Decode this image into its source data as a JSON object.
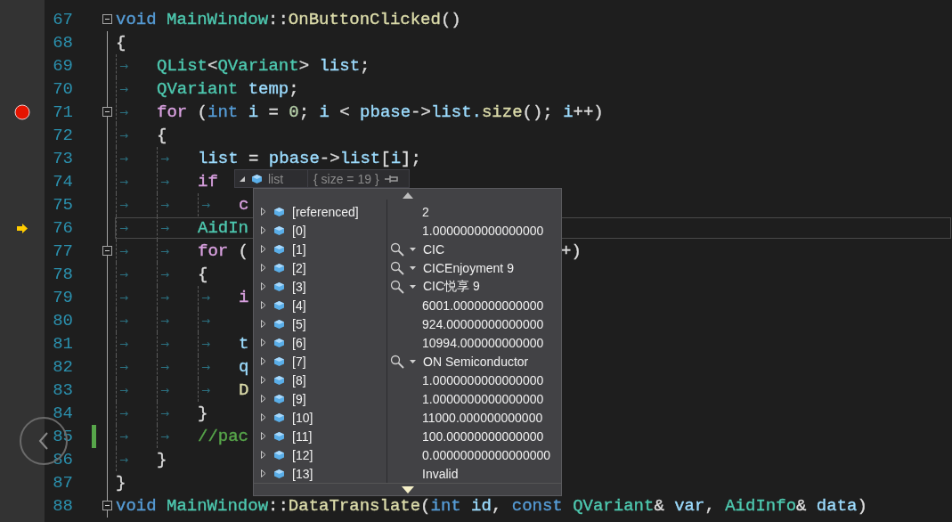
{
  "editor": {
    "lines": [
      {
        "number": "67",
        "collapsible": true,
        "tokens": [
          {
            "kind": "code",
            "text": "void ",
            "color": "#569cd6"
          },
          {
            "kind": "code",
            "text": "MainWindow",
            "color": "#4ec9b0"
          },
          {
            "kind": "code",
            "text": "::",
            "color": "#dcdcdc"
          },
          {
            "kind": "code",
            "text": "OnButtonClicked",
            "color": "#dcdcaa"
          },
          {
            "kind": "code",
            "text": "()",
            "color": "#dcdcdc"
          }
        ]
      },
      {
        "number": "68",
        "tokens": [
          {
            "kind": "code",
            "text": "{",
            "color": "#dcdcdc"
          }
        ]
      },
      {
        "number": "69",
        "tokens": [
          {
            "kind": "tab",
            "text": "→"
          },
          {
            "kind": "code",
            "text": "QList",
            "color": "#4ec9b0"
          },
          {
            "kind": "code",
            "text": "<",
            "color": "#dcdcdc"
          },
          {
            "kind": "code",
            "text": "QVariant",
            "color": "#4ec9b0"
          },
          {
            "kind": "code",
            "text": "> ",
            "color": "#dcdcdc"
          },
          {
            "kind": "code",
            "text": "list",
            "color": "#9cdcfe"
          },
          {
            "kind": "code",
            "text": ";",
            "color": "#dcdcdc"
          }
        ]
      },
      {
        "number": "70",
        "tokens": [
          {
            "kind": "tab",
            "text": "→"
          },
          {
            "kind": "code",
            "text": "QVariant ",
            "color": "#4ec9b0"
          },
          {
            "kind": "code",
            "text": "temp",
            "color": "#9cdcfe"
          },
          {
            "kind": "code",
            "text": ";",
            "color": "#dcdcdc"
          }
        ]
      },
      {
        "number": "71",
        "collapsible": true,
        "breakpoint": true,
        "tokens": [
          {
            "kind": "tab",
            "text": "→"
          },
          {
            "kind": "code",
            "text": "for ",
            "color": "#d8a0df"
          },
          {
            "kind": "code",
            "text": "(",
            "color": "#dcdcdc"
          },
          {
            "kind": "code",
            "text": "int ",
            "color": "#569cd6"
          },
          {
            "kind": "code",
            "text": "i",
            "color": "#9cdcfe"
          },
          {
            "kind": "code",
            "text": " = ",
            "color": "#dcdcdc"
          },
          {
            "kind": "code",
            "text": "0",
            "color": "#b5cea8"
          },
          {
            "kind": "code",
            "text": "; ",
            "color": "#dcdcdc"
          },
          {
            "kind": "code",
            "text": "i",
            "color": "#9cdcfe"
          },
          {
            "kind": "code",
            "text": " < ",
            "color": "#dcdcdc"
          },
          {
            "kind": "code",
            "text": "pbase",
            "color": "#9cdcfe"
          },
          {
            "kind": "code",
            "text": "->",
            "color": "#dcdcdc"
          },
          {
            "kind": "code",
            "text": "list.",
            "color": "#9cdcfe"
          },
          {
            "kind": "code",
            "text": "size",
            "color": "#dcdcaa"
          },
          {
            "kind": "code",
            "text": "(); ",
            "color": "#dcdcdc"
          },
          {
            "kind": "code",
            "text": "i",
            "color": "#9cdcfe"
          },
          {
            "kind": "code",
            "text": "++)",
            "color": "#dcdcdc"
          }
        ]
      },
      {
        "number": "72",
        "tokens": [
          {
            "kind": "tab",
            "text": "→"
          },
          {
            "kind": "code",
            "text": "{",
            "color": "#dcdcdc"
          }
        ]
      },
      {
        "number": "73",
        "tokens": [
          {
            "kind": "tab",
            "text": "→"
          },
          {
            "kind": "tab",
            "text": "→"
          },
          {
            "kind": "code",
            "text": "list",
            "color": "#9cdcfe"
          },
          {
            "kind": "code",
            "text": " = ",
            "color": "#dcdcdc"
          },
          {
            "kind": "code",
            "text": "pbase",
            "color": "#9cdcfe"
          },
          {
            "kind": "code",
            "text": "->",
            "color": "#dcdcdc"
          },
          {
            "kind": "code",
            "text": "list",
            "color": "#9cdcfe"
          },
          {
            "kind": "code",
            "text": "[",
            "color": "#dcdcdc"
          },
          {
            "kind": "code",
            "text": "i",
            "color": "#9cdcfe"
          },
          {
            "kind": "code",
            "text": "];",
            "color": "#dcdcdc"
          }
        ]
      },
      {
        "number": "74",
        "tokens": [
          {
            "kind": "tab",
            "text": "→"
          },
          {
            "kind": "tab",
            "text": "→"
          },
          {
            "kind": "code",
            "text": "if",
            "color": "#d8a0df"
          }
        ]
      },
      {
        "number": "75",
        "tokens": [
          {
            "kind": "tab",
            "text": "→"
          },
          {
            "kind": "tab",
            "text": "→"
          },
          {
            "kind": "tab",
            "text": "→"
          },
          {
            "kind": "code",
            "text": "c",
            "color": "#d8a0df"
          }
        ]
      },
      {
        "number": "76",
        "current": true,
        "tokens": [
          {
            "kind": "tab",
            "text": "→"
          },
          {
            "kind": "tab",
            "text": "→"
          },
          {
            "kind": "code",
            "text": "AidIn",
            "color": "#4ec9b0"
          }
        ]
      },
      {
        "number": "77",
        "collapsible": true,
        "tokens": [
          {
            "kind": "tab",
            "text": "→"
          },
          {
            "kind": "tab",
            "text": "→"
          },
          {
            "kind": "code",
            "text": "for ",
            "color": "#d8a0df"
          },
          {
            "kind": "code",
            "text": "(",
            "color": "#dcdcdc"
          }
        ],
        "right": [
          {
            "kind": "code",
            "text": "+)",
            "color": "#dcdcdc"
          }
        ]
      },
      {
        "number": "78",
        "tokens": [
          {
            "kind": "tab",
            "text": "→"
          },
          {
            "kind": "tab",
            "text": "→"
          },
          {
            "kind": "code",
            "text": "{",
            "color": "#dcdcdc"
          }
        ]
      },
      {
        "number": "79",
        "tokens": [
          {
            "kind": "tab",
            "text": "→"
          },
          {
            "kind": "tab",
            "text": "→"
          },
          {
            "kind": "tab",
            "text": "→"
          },
          {
            "kind": "code",
            "text": "i",
            "color": "#d8a0df"
          }
        ]
      },
      {
        "number": "80",
        "tokens": [
          {
            "kind": "tab",
            "text": "→"
          },
          {
            "kind": "tab",
            "text": "→"
          },
          {
            "kind": "tab",
            "text": "→"
          }
        ]
      },
      {
        "number": "81",
        "tokens": [
          {
            "kind": "tab",
            "text": "→"
          },
          {
            "kind": "tab",
            "text": "→"
          },
          {
            "kind": "tab",
            "text": "→"
          },
          {
            "kind": "code",
            "text": "t",
            "color": "#9cdcfe"
          }
        ]
      },
      {
        "number": "82",
        "tokens": [
          {
            "kind": "tab",
            "text": "→"
          },
          {
            "kind": "tab",
            "text": "→"
          },
          {
            "kind": "tab",
            "text": "→"
          },
          {
            "kind": "code",
            "text": "q",
            "color": "#9cdcfe"
          }
        ]
      },
      {
        "number": "83",
        "tokens": [
          {
            "kind": "tab",
            "text": "→"
          },
          {
            "kind": "tab",
            "text": "→"
          },
          {
            "kind": "tab",
            "text": "→"
          },
          {
            "kind": "code",
            "text": "D",
            "color": "#dcdcaa"
          }
        ]
      },
      {
        "number": "84",
        "tokens": [
          {
            "kind": "tab",
            "text": "→"
          },
          {
            "kind": "tab",
            "text": "→"
          },
          {
            "kind": "code",
            "text": "}",
            "color": "#dcdcdc"
          }
        ]
      },
      {
        "number": "85",
        "changed": true,
        "tokens": [
          {
            "kind": "tab",
            "text": "→"
          },
          {
            "kind": "tab",
            "text": "→"
          },
          {
            "kind": "code",
            "text": "//pac",
            "color": "#57a64a"
          }
        ]
      },
      {
        "number": "86",
        "tokens": [
          {
            "kind": "tab",
            "text": "→"
          },
          {
            "kind": "code",
            "text": "}",
            "color": "#dcdcdc"
          }
        ]
      },
      {
        "number": "87",
        "tokens": [
          {
            "kind": "code",
            "text": "}",
            "color": "#dcdcdc"
          }
        ]
      },
      {
        "number": "88",
        "collapsible": true,
        "tokens": [
          {
            "kind": "code",
            "text": "void ",
            "color": "#569cd6"
          },
          {
            "kind": "code",
            "text": "MainWindow",
            "color": "#4ec9b0"
          },
          {
            "kind": "code",
            "text": "::",
            "color": "#dcdcdc"
          },
          {
            "kind": "code",
            "text": "DataTranslate",
            "color": "#dcdcaa"
          },
          {
            "kind": "code",
            "text": "(",
            "color": "#dcdcdc"
          },
          {
            "kind": "code",
            "text": "int ",
            "color": "#569cd6"
          },
          {
            "kind": "code",
            "text": "id",
            "color": "#9cdcfe"
          },
          {
            "kind": "code",
            "text": ", ",
            "color": "#dcdcdc"
          },
          {
            "kind": "code",
            "text": "const ",
            "color": "#569cd6"
          },
          {
            "kind": "code",
            "text": "QVariant",
            "color": "#4ec9b0"
          },
          {
            "kind": "code",
            "text": "& ",
            "color": "#dcdcdc"
          },
          {
            "kind": "code",
            "text": "var",
            "color": "#9cdcfe"
          },
          {
            "kind": "code",
            "text": ", ",
            "color": "#dcdcdc"
          },
          {
            "kind": "code",
            "text": "AidInfo",
            "color": "#4ec9b0"
          },
          {
            "kind": "code",
            "text": "& ",
            "color": "#dcdcdc"
          },
          {
            "kind": "code",
            "text": "data",
            "color": "#9cdcfe"
          },
          {
            "kind": "code",
            "text": ")",
            "color": "#dcdcdc"
          }
        ]
      }
    ]
  },
  "datatip": {
    "name": "list",
    "value": "{ size = 19 }",
    "rows": [
      {
        "name": "[referenced]",
        "value": "2"
      },
      {
        "name": "[0]",
        "value": "1.0000000000000000"
      },
      {
        "name": "[1]",
        "value": "CIC",
        "visualizer": true
      },
      {
        "name": "[2]",
        "value": "CICEnjoyment 9",
        "visualizer": true
      },
      {
        "name": "[3]",
        "value": "CIC悦享 9",
        "visualizer": true
      },
      {
        "name": "[4]",
        "value": "6001.0000000000000"
      },
      {
        "name": "[5]",
        "value": "924.00000000000000"
      },
      {
        "name": "[6]",
        "value": "10994.000000000000"
      },
      {
        "name": "[7]",
        "value": "ON Semiconductor",
        "visualizer": true
      },
      {
        "name": "[8]",
        "value": "1.0000000000000000"
      },
      {
        "name": "[9]",
        "value": "1.0000000000000000"
      },
      {
        "name": "[10]",
        "value": "11000.000000000000"
      },
      {
        "name": "[11]",
        "value": "100.00000000000000"
      },
      {
        "name": "[12]",
        "value": "0.00000000000000000"
      },
      {
        "name": "[13]",
        "value": "Invalid"
      }
    ]
  }
}
